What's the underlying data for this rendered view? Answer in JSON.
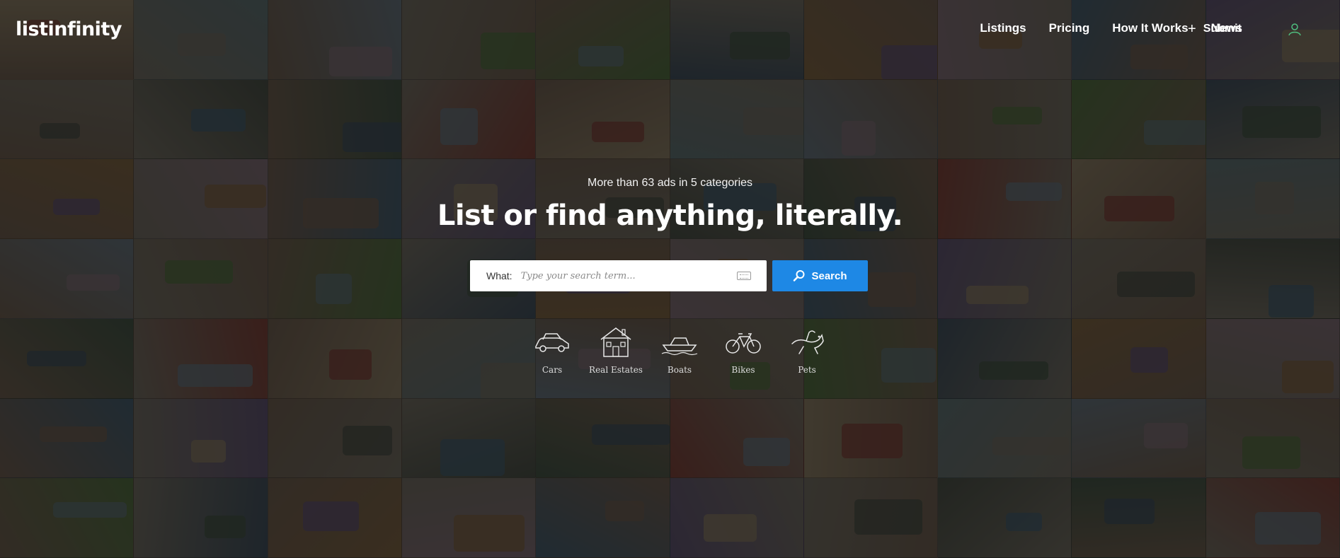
{
  "brand": {
    "logo_text": "listinfinity"
  },
  "nav": {
    "items": [
      {
        "label": "Listings"
      },
      {
        "label": "Pricing"
      },
      {
        "label": "How It Works"
      },
      {
        "label": "News"
      }
    ],
    "submit_label": "Submit",
    "user_icon": "user-icon"
  },
  "hero": {
    "subtitle": "More than 63 ads in 5 categories",
    "title": "List or find anything, literally."
  },
  "search": {
    "label": "What:",
    "placeholder": "Type your search term...",
    "value": "",
    "button_label": "Search",
    "keyboard_icon": "keyboard-icon",
    "button_icon": "search-icon"
  },
  "categories": [
    {
      "label": "Cars",
      "icon": "car-icon"
    },
    {
      "label": "Real Estates",
      "icon": "house-icon"
    },
    {
      "label": "Boats",
      "icon": "boat-icon"
    },
    {
      "label": "Bikes",
      "icon": "bicycle-icon"
    },
    {
      "label": "Pets",
      "icon": "pet-icon"
    }
  ],
  "colors": {
    "accent": "#1e88e5",
    "overlay": "#0a0a0a",
    "text": "#ffffff"
  }
}
